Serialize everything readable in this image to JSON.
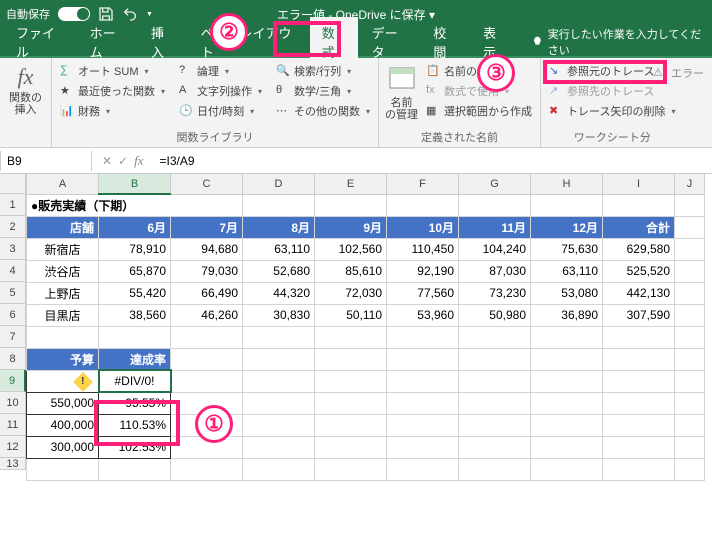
{
  "titlebar": {
    "autosave": "自動保存",
    "title": "エラー値 - OneDrive に保存 ▾"
  },
  "menu": {
    "file": "ファイル",
    "home": "ホーム",
    "insert": "挿入",
    "pagelayout": "ページレイアウト",
    "formulas": "数式",
    "data": "データ",
    "review": "校閲",
    "view": "表示",
    "tellme": "実行したい作業を入力してください"
  },
  "ribbon": {
    "fx_insert": "関数の\n挿入",
    "autosum": "オート SUM",
    "recent": "最近使った関数",
    "financial": "財務",
    "logical": "論理",
    "text": "文字列操作",
    "datetime": "日付/時刻",
    "lookup": "検索/行列",
    "math": "数学/三角",
    "more": "その他の関数",
    "group_lib": "関数ライブラリ",
    "name_mgr": "名前\nの管理",
    "define": "名前の定義",
    "use_fml": "数式で使用",
    "create_sel": "選択範囲から作成",
    "group_names": "定義された名前",
    "trace_prec": "参照元のトレース",
    "trace_dep": "参照先のトレース",
    "remove_arrows": "トレース矢印の削除",
    "err": "エラー",
    "group_audit": "ワークシート分"
  },
  "namebox": "B9",
  "formula": "=I3/A9",
  "cols": [
    "A",
    "B",
    "C",
    "D",
    "E",
    "F",
    "G",
    "H",
    "I",
    "J"
  ],
  "rows": [
    "1",
    "2",
    "3",
    "4",
    "5",
    "6",
    "7",
    "8",
    "9",
    "10",
    "11",
    "12",
    "13"
  ],
  "table": {
    "title": "●販売実績（下期）",
    "headers": [
      "店舗",
      "6月",
      "7月",
      "8月",
      "9月",
      "10月",
      "11月",
      "12月",
      "合計"
    ],
    "rows": [
      {
        "store": "新宿店",
        "v": [
          "78,910",
          "94,680",
          "63,110",
          "102,560",
          "110,450",
          "104,240",
          "75,630",
          "629,580"
        ]
      },
      {
        "store": "渋谷店",
        "v": [
          "65,870",
          "79,030",
          "52,680",
          "85,610",
          "92,190",
          "87,030",
          "63,110",
          "525,520"
        ]
      },
      {
        "store": "上野店",
        "v": [
          "55,420",
          "66,490",
          "44,320",
          "72,030",
          "77,560",
          "73,230",
          "53,080",
          "442,130"
        ]
      },
      {
        "store": "目黒店",
        "v": [
          "38,560",
          "46,260",
          "30,830",
          "50,110",
          "53,960",
          "50,980",
          "36,890",
          "307,590"
        ]
      }
    ]
  },
  "lower": {
    "headers": [
      "予算",
      "達成率"
    ],
    "rows": [
      {
        "a": "",
        "b": "#DIV/0!"
      },
      {
        "a": "550,000",
        "b": "95.55%"
      },
      {
        "a": "400,000",
        "b": "110.53%"
      },
      {
        "a": "300,000",
        "b": "102.53%"
      }
    ]
  },
  "callouts": {
    "c1": "①",
    "c2": "②",
    "c3": "③"
  },
  "chart_data": {
    "type": "table",
    "title": "販売実績（下期）",
    "columns": [
      "店舗",
      "6月",
      "7月",
      "8月",
      "9月",
      "10月",
      "11月",
      "12月",
      "合計"
    ],
    "rows": [
      [
        "新宿店",
        78910,
        94680,
        63110,
        102560,
        110450,
        104240,
        75630,
        629580
      ],
      [
        "渋谷店",
        65870,
        79030,
        52680,
        85610,
        92190,
        87030,
        63110,
        525520
      ],
      [
        "上野店",
        55420,
        66490,
        44320,
        72030,
        77560,
        73230,
        53080,
        442130
      ],
      [
        "目黒店",
        38560,
        46260,
        30830,
        50110,
        53960,
        50980,
        36890,
        307590
      ]
    ],
    "secondary": {
      "columns": [
        "予算",
        "達成率"
      ],
      "rows": [
        [
          null,
          "#DIV/0!"
        ],
        [
          550000,
          "95.55%"
        ],
        [
          400000,
          "110.53%"
        ],
        [
          300000,
          "102.53%"
        ]
      ]
    }
  }
}
